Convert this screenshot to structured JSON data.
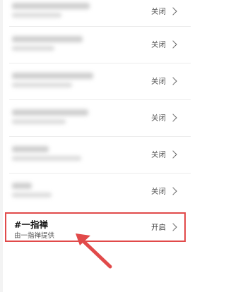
{
  "settings_list": {
    "items": [
      {
        "status": "关闭"
      },
      {
        "status": "关闭"
      },
      {
        "status": "关闭"
      },
      {
        "status": "关闭"
      },
      {
        "status": "关闭"
      },
      {
        "status": "关闭"
      }
    ],
    "highlighted": {
      "title": "#一指禅",
      "subtitle": "由一指禅提供",
      "status": "开启"
    }
  },
  "colors": {
    "highlight_border": "#e14a4a",
    "arrow": "#e14a4a"
  }
}
